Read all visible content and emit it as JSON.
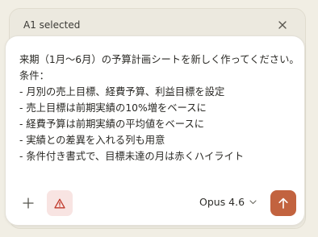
{
  "header": {
    "title": "A1 selected",
    "close_icon": "close-icon"
  },
  "prompt": {
    "lines": [
      "来期（1月〜6月）の予算計画シートを新しく作ってください。",
      "条件：",
      "- 月別の売上目標、経費予算、利益目標を設定",
      "- 売上目標は前期実績の10%増をベースに",
      "- 経費予算は前期実績の平均値をベースに",
      "- 実績との差異を入れる列も用意",
      "- 条件付き書式で、目標未達の月は赤くハイライト"
    ]
  },
  "toolbar": {
    "add_icon": "plus-icon",
    "warning_icon": "warning-triangle-icon",
    "model_label": "Opus 4.6",
    "model_dropdown_icon": "chevron-down-icon",
    "send_icon": "arrow-up-icon"
  },
  "colors": {
    "send_button": "#c2633f",
    "warning_bg": "#f8e4e2",
    "warning_icon": "#c0392b"
  }
}
